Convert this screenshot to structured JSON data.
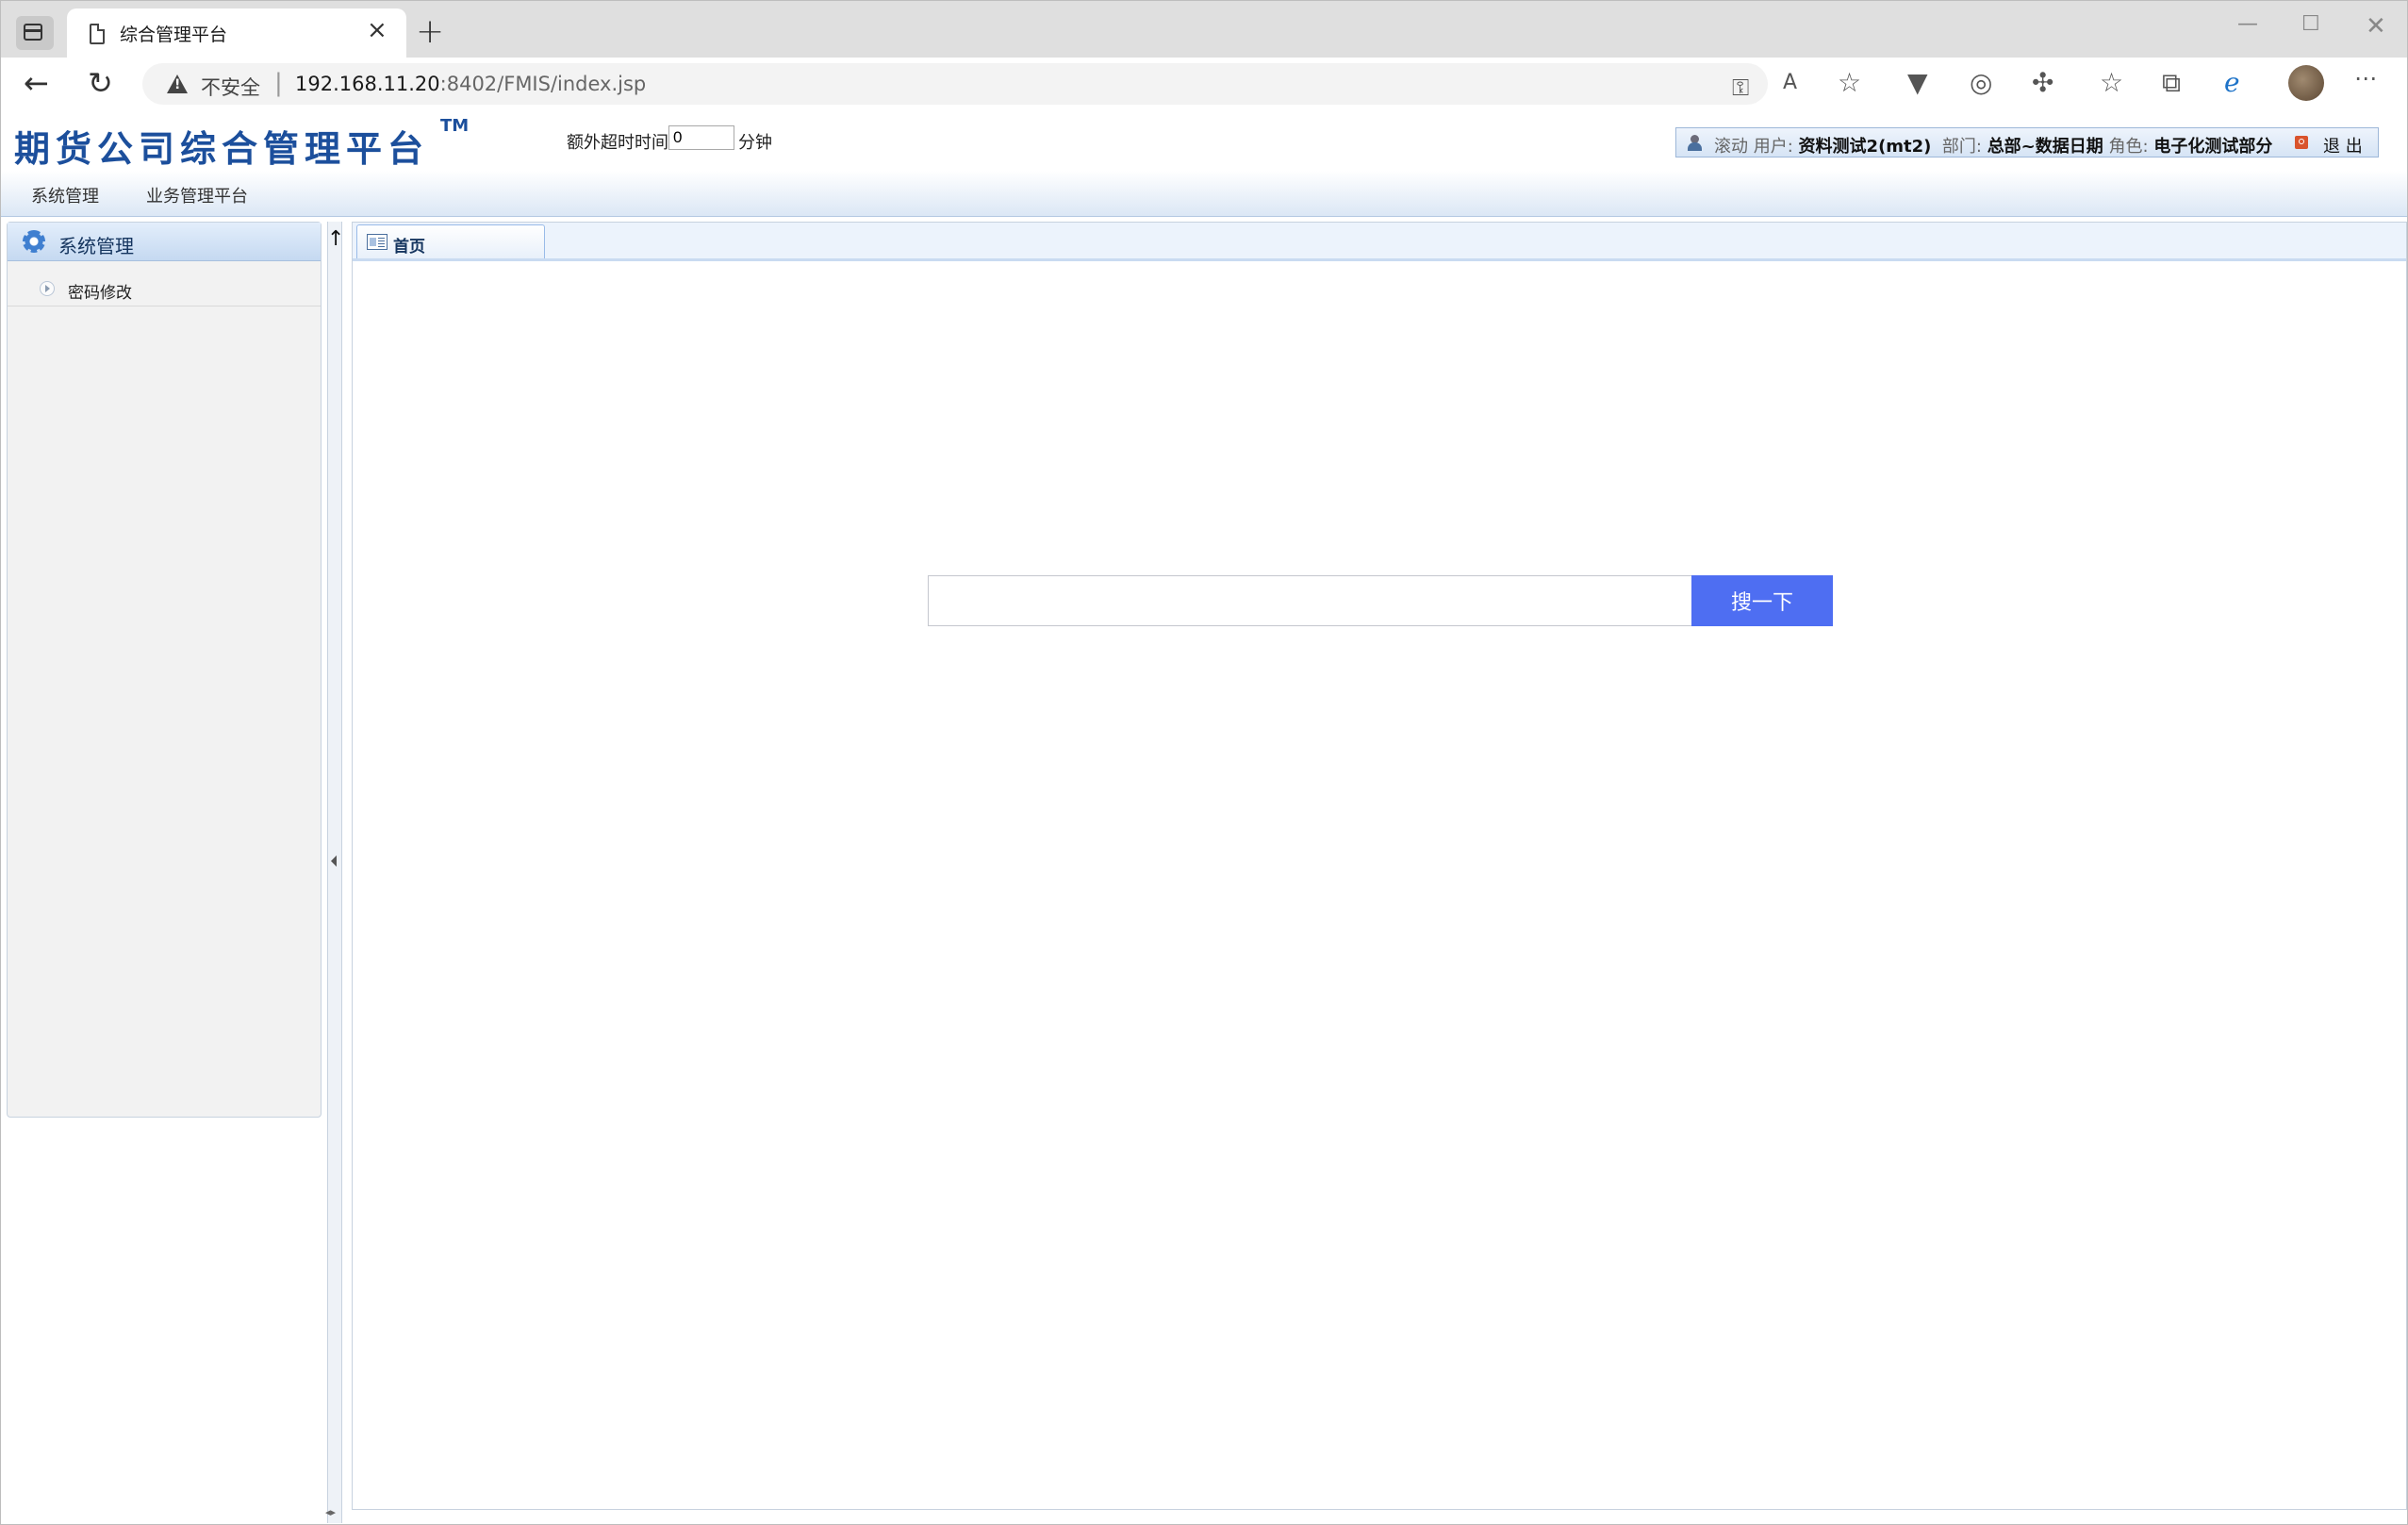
{
  "browser": {
    "tab_title": "综合管理平台",
    "new_tab_symbol": "+",
    "close_symbol": "×",
    "security_label": "不安全",
    "url_host": "192.168.11.20",
    "url_rest": ":8402/FMIS/index.jsp",
    "icons": [
      "tabs-icon",
      "page-icon",
      "back-arrow-icon",
      "refresh-icon",
      "warning-icon",
      "key-icon",
      "read-aloud-icon",
      "add-favorite-icon",
      "extension-v-icon",
      "extension-circle-icon",
      "extensions-puzzle-icon",
      "favorites-icon",
      "collections-icon",
      "ie-mode-icon",
      "profile-avatar",
      "more-menu-icon"
    ]
  },
  "header": {
    "logo": "期货公司综合管理平台",
    "logo_tm": "TM",
    "timeout_label": "额外超时时间",
    "timeout_value": "0",
    "timeout_unit": "分钟",
    "user": {
      "scroll_label": "滚动",
      "user_label": "用户:",
      "user_value": "资料测试2(mt2)",
      "dept_label": "部门:",
      "dept_value": "总部~数据日期",
      "role_label": "角色:",
      "role_value": "电子化测试部分",
      "logout": "退 出"
    }
  },
  "menubar": {
    "items": [
      "系统管理",
      "业务管理平台"
    ]
  },
  "sidebar": {
    "title": "系统管理",
    "items": [
      {
        "label": "密码修改"
      }
    ]
  },
  "content": {
    "tabs": [
      {
        "label": "首页"
      }
    ],
    "search": {
      "value": "",
      "button": "搜一下"
    }
  },
  "colors": {
    "brand_blue": "#1c4f9c",
    "search_button": "#4e6ef2",
    "panel_header": "#c5d9f1"
  }
}
